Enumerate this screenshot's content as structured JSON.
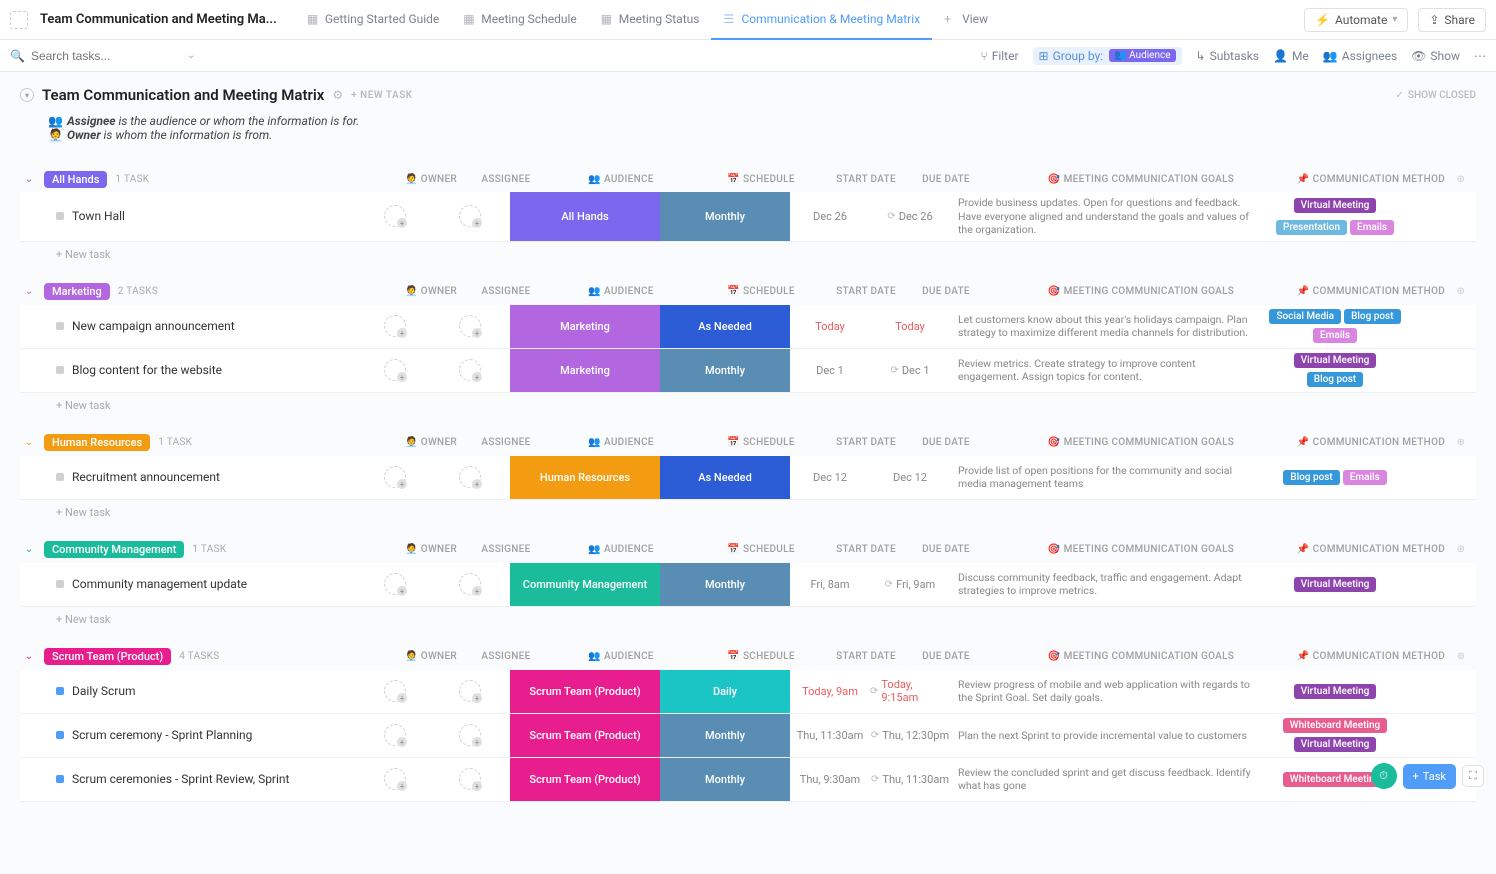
{
  "workspace": {
    "name": "Team Communication and Meeting Ma..."
  },
  "tabs": [
    {
      "label": "Getting Started Guide",
      "active": false
    },
    {
      "label": "Meeting Schedule",
      "active": false
    },
    {
      "label": "Meeting Status",
      "active": false
    },
    {
      "label": "Communication & Meeting Matrix",
      "active": true
    },
    {
      "label": "View",
      "active": false,
      "is_add": true
    }
  ],
  "topbar": {
    "automate": "Automate",
    "share": "Share"
  },
  "search": {
    "placeholder": "Search tasks..."
  },
  "toolbar": {
    "filter": "Filter",
    "groupby_label": "Group by:",
    "groupby_value": "Audience",
    "subtasks": "Subtasks",
    "me": "Me",
    "assignees": "Assignees",
    "show": "Show"
  },
  "page": {
    "title": "Team Communication and Meeting Matrix",
    "new_task": "+ NEW TASK",
    "show_closed": "SHOW CLOSED"
  },
  "description": {
    "line1_label": "Assignee",
    "line1_rest": " is the audience or whom the information is for.",
    "line2_label": "Owner",
    "line2_rest": " is whom the information is from."
  },
  "columns": {
    "owner": "OWNER",
    "assignee": "ASSIGNEE",
    "audience": "AUDIENCE",
    "schedule": "SCHEDULE",
    "start": "START DATE",
    "due": "DUE DATE",
    "goals": "MEETING COMMUNICATION GOALS",
    "method": "COMMUNICATION METHOD"
  },
  "new_task_label": "New task",
  "colors": {
    "audience": {
      "All Hands": "#7b68ee",
      "Marketing": "#b266e0",
      "Human Resources": "#f39c12",
      "Community Management": "#1abc9c",
      "Scrum Team (Product)": "#e91e8e"
    },
    "schedule": {
      "Monthly": "#5a8db3",
      "As Needed": "#2d5dd6",
      "Daily": "#1cc5c5"
    },
    "method": {
      "Virtual Meeting": "#8e44ad",
      "Presentation": "#6fb8e0",
      "Emails": "#d986e0",
      "Social Media": "#3498db",
      "Blog post": "#3498db",
      "Whiteboard Meeting": "#e85d8f"
    }
  },
  "groups": [
    {
      "name": "All Hands",
      "color": "#7b68ee",
      "count": "1 TASK",
      "tasks": [
        {
          "name": "Town Hall",
          "status": "grey",
          "audience": "All Hands",
          "schedule": "Monthly",
          "start": "Dec 26",
          "due": "Dec 26",
          "recur": true,
          "goals": "Provide business updates. Open for questions and feedback. Have everyone aligned and understand the goals and values of the organization.",
          "methods": [
            "Virtual Meeting",
            "Presentation",
            "Emails"
          ]
        }
      ]
    },
    {
      "name": "Marketing",
      "color": "#b266e0",
      "count": "2 TASKS",
      "tasks": [
        {
          "name": "New campaign announcement",
          "status": "grey",
          "audience": "Marketing",
          "schedule": "As Needed",
          "start": "Today",
          "start_today": true,
          "due": "Today",
          "due_today": true,
          "goals": "Let customers know about this year's holidays campaign. Plan strategy to maximize different media channels for distribution.",
          "methods": [
            "Social Media",
            "Blog post",
            "Emails"
          ]
        },
        {
          "name": "Blog content for the website",
          "status": "grey",
          "audience": "Marketing",
          "schedule": "Monthly",
          "start": "Dec 1",
          "due": "Dec 1",
          "recur": true,
          "goals": "Review metrics. Create strategy to improve content engagement. Assign topics for content.",
          "methods": [
            "Virtual Meeting",
            "Blog post"
          ]
        }
      ]
    },
    {
      "name": "Human Resources",
      "color": "#f39c12",
      "count": "1 TASK",
      "tasks": [
        {
          "name": "Recruitment announcement",
          "status": "grey",
          "audience": "Human Resources",
          "schedule": "As Needed",
          "start": "Dec 12",
          "due": "Dec 12",
          "goals": "Provide list of open positions for the community and social media management teams",
          "methods": [
            "Blog post",
            "Emails"
          ]
        }
      ]
    },
    {
      "name": "Community Management",
      "color": "#1abc9c",
      "count": "1 TASK",
      "tasks": [
        {
          "name": "Community management update",
          "status": "grey",
          "audience": "Community Management",
          "schedule": "Monthly",
          "start": "Fri, 8am",
          "due": "Fri, 9am",
          "recur": true,
          "goals": "Discuss community feedback, traffic and engagement. Adapt strategies to improve metrics.",
          "methods": [
            "Virtual Meeting"
          ]
        }
      ]
    },
    {
      "name": "Scrum Team (Product)",
      "color": "#e91e8e",
      "count": "4 TASKS",
      "no_new_task": true,
      "tasks": [
        {
          "name": "Daily Scrum",
          "status": "blue",
          "audience": "Scrum Team (Product)",
          "schedule": "Daily",
          "start": "Today, 9am",
          "start_today": true,
          "due": "Today, 9:15am",
          "due_today": true,
          "recur": true,
          "goals": "Review progress of mobile and web application with regards to the Sprint Goal. Set daily goals.",
          "methods": [
            "Virtual Meeting"
          ]
        },
        {
          "name": "Scrum ceremony - Sprint Planning",
          "status": "blue",
          "audience": "Scrum Team (Product)",
          "schedule": "Monthly",
          "start": "Thu, 11:30am",
          "due": "Thu, 12:30pm",
          "recur": true,
          "goals": "Plan the next Sprint to provide incremental value to customers",
          "methods": [
            "Whiteboard Meeting",
            "Virtual Meeting"
          ]
        },
        {
          "name": "Scrum ceremonies - Sprint Review, Sprint",
          "status": "blue",
          "audience": "Scrum Team (Product)",
          "schedule": "Monthly",
          "start": "Thu, 9:30am",
          "due": "Thu, 11:30am",
          "recur": true,
          "goals": "Review the concluded sprint and get discuss feedback. Identify what has gone",
          "methods": [
            "Whiteboard Meeting"
          ]
        }
      ]
    }
  ],
  "fab": {
    "task": "Task"
  }
}
